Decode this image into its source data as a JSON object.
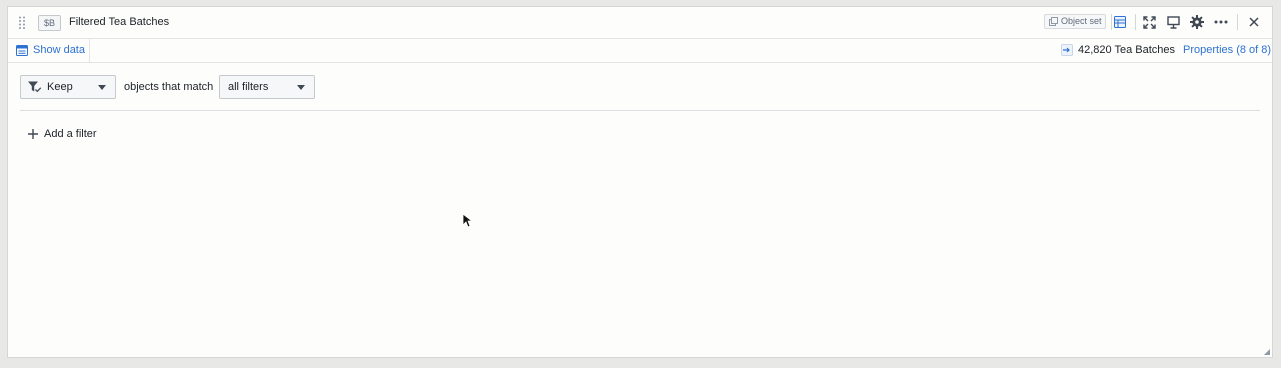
{
  "header": {
    "variable_tag": "$B",
    "title": "Filtered Tea Batches",
    "object_set_label": "Object set",
    "icons": [
      "drag-handle-icon",
      "table-icon",
      "fullscreen-icon",
      "present-icon",
      "gear-icon",
      "more-icon",
      "close-icon"
    ]
  },
  "subbar": {
    "show_data_label": "Show data",
    "count_label": "42,820 Tea Batches",
    "properties_label": "Properties (8 of 8)"
  },
  "filter": {
    "mode_label": "Keep",
    "connector_text": "objects that match",
    "match_label": "all filters",
    "add_filter_label": "Add a filter"
  },
  "colors": {
    "accent": "#2d72d2",
    "text": "#1c2127",
    "muted": "#5f6b7c",
    "panel_bg": "#fdfdfc"
  }
}
